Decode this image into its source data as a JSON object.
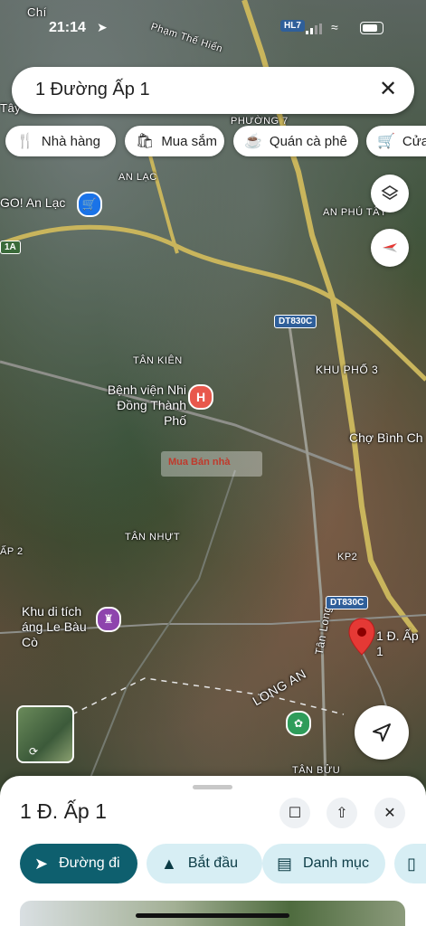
{
  "status": {
    "time": "21:14",
    "route_badge": "HL7"
  },
  "search": {
    "query": "1 Đường Ấp 1"
  },
  "chips": [
    {
      "icon": "fork-knife-icon",
      "label": "Nhà hàng"
    },
    {
      "icon": "shopping-bag-icon",
      "label": "Mua sắm"
    },
    {
      "icon": "coffee-cup-icon",
      "label": "Quán cà phê"
    },
    {
      "icon": "cart-icon",
      "label": "Cửa"
    }
  ],
  "map": {
    "area_labels": [
      "Chí",
      "Phạm Thế Hiển",
      "PHƯỜNG 7",
      "AN LẠC",
      "AN PHÚ TÂY",
      "TÂN KIÊN",
      "KHU PHỐ 3",
      "TÂN NHỰT",
      "KP2",
      "LONG AN",
      "Tân Long",
      "TÂN BỬU",
      "ẤP 2",
      "Tây",
      "1A",
      "GO! An Lạc",
      "Chợ Bình Ch"
    ],
    "road_shields": [
      "DT830C",
      "DT830C"
    ],
    "poi": {
      "hospital": "Bệnh viện Nhi Đồng Thành Phố",
      "relic": "Khu di tích áng Le Bàu Cò",
      "pin": "1 Đ. Ấp 1"
    },
    "watermark": "Mua Bán nhà"
  },
  "place": {
    "title": "1 Đ. Ấp 1",
    "actions": [
      {
        "icon": "directions-icon",
        "label": "Đường đi"
      },
      {
        "icon": "navigation-arrow-icon",
        "label": "Bắt đầu"
      },
      {
        "icon": "list-icon",
        "label": "Danh mục"
      }
    ]
  },
  "colors": {
    "primary": "#0b57d0",
    "action_dark": "#0e5f6e",
    "action_light": "#d7eef4",
    "pin_red": "#e53935"
  }
}
